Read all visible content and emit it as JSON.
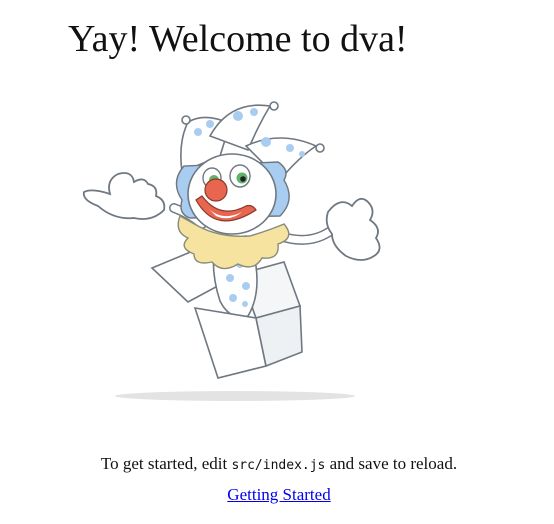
{
  "header": {
    "title": "Yay! Welcome to dva!"
  },
  "illustration": {
    "icon": "dva-clown-jack-in-the-box"
  },
  "instructions": {
    "prefix": "To get started, edit",
    "file": "src/index.js",
    "suffix": "and save to reload."
  },
  "links": {
    "getting_started": "Getting Started"
  },
  "colors": {
    "link": "#0000ee",
    "text": "#111111",
    "hat_blue": "#a9cdf0",
    "nose_red": "#e8654f",
    "collar_yellow": "#f7e3a0"
  }
}
